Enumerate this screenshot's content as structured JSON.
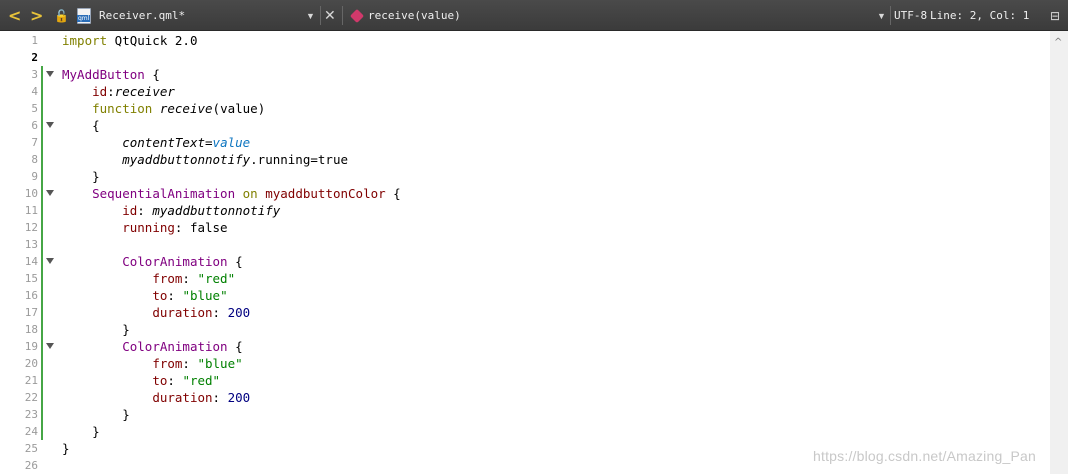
{
  "toolbar": {
    "back_glyph": "<",
    "forward_glyph": ">",
    "lock_glyph": "🔓",
    "file_name": "Receiver.qml*",
    "dropdown_glyph": "▼",
    "close_glyph": "✕",
    "function_name": "receive(value)",
    "function_dropdown_glyph": "▼",
    "encoding": "UTF-8",
    "cursor_position": "Line: 2, Col: 1",
    "split_glyph": "⊟"
  },
  "editor": {
    "current_line": 2,
    "lines": [
      {
        "n": "1",
        "fold": false,
        "code": [
          {
            "t": "import",
            "c": "kw"
          },
          {
            "t": " QtQuick 2.0",
            "c": ""
          }
        ]
      },
      {
        "n": "2",
        "fold": false,
        "code": []
      },
      {
        "n": "3",
        "fold": true,
        "code": [
          {
            "t": "MyAddButton",
            "c": "type"
          },
          {
            "t": " {",
            "c": ""
          }
        ]
      },
      {
        "n": "4",
        "fold": false,
        "code": [
          {
            "t": "    ",
            "c": ""
          },
          {
            "t": "id",
            "c": "prop"
          },
          {
            "t": ":",
            "c": ""
          },
          {
            "t": "receiver",
            "c": "ital"
          }
        ]
      },
      {
        "n": "5",
        "fold": false,
        "code": [
          {
            "t": "    ",
            "c": ""
          },
          {
            "t": "function",
            "c": "kw"
          },
          {
            "t": " ",
            "c": ""
          },
          {
            "t": "receive",
            "c": "ital"
          },
          {
            "t": "(value)",
            "c": ""
          }
        ]
      },
      {
        "n": "6",
        "fold": true,
        "code": [
          {
            "t": "    {",
            "c": ""
          }
        ]
      },
      {
        "n": "7",
        "fold": false,
        "code": [
          {
            "t": "        ",
            "c": ""
          },
          {
            "t": "contentText",
            "c": "ital"
          },
          {
            "t": "=",
            "c": ""
          },
          {
            "t": "value",
            "c": "val"
          }
        ]
      },
      {
        "n": "8",
        "fold": false,
        "code": [
          {
            "t": "        ",
            "c": ""
          },
          {
            "t": "myaddbuttonnotify",
            "c": "ital"
          },
          {
            "t": ".running=true",
            "c": ""
          }
        ]
      },
      {
        "n": "9",
        "fold": false,
        "code": [
          {
            "t": "    }",
            "c": ""
          }
        ]
      },
      {
        "n": "10",
        "fold": true,
        "code": [
          {
            "t": "    ",
            "c": ""
          },
          {
            "t": "SequentialAnimation",
            "c": "type"
          },
          {
            "t": " ",
            "c": ""
          },
          {
            "t": "on",
            "c": "kw"
          },
          {
            "t": " ",
            "c": ""
          },
          {
            "t": "myaddbuttonColor",
            "c": "prop"
          },
          {
            "t": " {",
            "c": ""
          }
        ]
      },
      {
        "n": "11",
        "fold": false,
        "code": [
          {
            "t": "        ",
            "c": ""
          },
          {
            "t": "id",
            "c": "prop"
          },
          {
            "t": ": ",
            "c": ""
          },
          {
            "t": "myaddbuttonnotify",
            "c": "ital"
          }
        ]
      },
      {
        "n": "12",
        "fold": false,
        "code": [
          {
            "t": "        ",
            "c": ""
          },
          {
            "t": "running",
            "c": "prop"
          },
          {
            "t": ": false",
            "c": ""
          }
        ]
      },
      {
        "n": "13",
        "fold": false,
        "code": []
      },
      {
        "n": "14",
        "fold": true,
        "code": [
          {
            "t": "        ",
            "c": ""
          },
          {
            "t": "ColorAnimation",
            "c": "type"
          },
          {
            "t": " {",
            "c": ""
          }
        ]
      },
      {
        "n": "15",
        "fold": false,
        "code": [
          {
            "t": "            ",
            "c": ""
          },
          {
            "t": "from",
            "c": "prop"
          },
          {
            "t": ": ",
            "c": ""
          },
          {
            "t": "\"red\"",
            "c": "str"
          }
        ]
      },
      {
        "n": "16",
        "fold": false,
        "code": [
          {
            "t": "            ",
            "c": ""
          },
          {
            "t": "to",
            "c": "prop"
          },
          {
            "t": ": ",
            "c": ""
          },
          {
            "t": "\"blue\"",
            "c": "str"
          }
        ]
      },
      {
        "n": "17",
        "fold": false,
        "code": [
          {
            "t": "            ",
            "c": ""
          },
          {
            "t": "duration",
            "c": "prop"
          },
          {
            "t": ": ",
            "c": ""
          },
          {
            "t": "200",
            "c": "num"
          }
        ]
      },
      {
        "n": "18",
        "fold": false,
        "code": [
          {
            "t": "        }",
            "c": ""
          }
        ]
      },
      {
        "n": "19",
        "fold": true,
        "code": [
          {
            "t": "        ",
            "c": ""
          },
          {
            "t": "ColorAnimation",
            "c": "type"
          },
          {
            "t": " {",
            "c": ""
          }
        ]
      },
      {
        "n": "20",
        "fold": false,
        "code": [
          {
            "t": "            ",
            "c": ""
          },
          {
            "t": "from",
            "c": "prop"
          },
          {
            "t": ": ",
            "c": ""
          },
          {
            "t": "\"blue\"",
            "c": "str"
          }
        ]
      },
      {
        "n": "21",
        "fold": false,
        "code": [
          {
            "t": "            ",
            "c": ""
          },
          {
            "t": "to",
            "c": "prop"
          },
          {
            "t": ": ",
            "c": ""
          },
          {
            "t": "\"red\"",
            "c": "str"
          }
        ]
      },
      {
        "n": "22",
        "fold": false,
        "code": [
          {
            "t": "            ",
            "c": ""
          },
          {
            "t": "duration",
            "c": "prop"
          },
          {
            "t": ": ",
            "c": ""
          },
          {
            "t": "200",
            "c": "num"
          }
        ]
      },
      {
        "n": "23",
        "fold": false,
        "code": [
          {
            "t": "        }",
            "c": ""
          }
        ]
      },
      {
        "n": "24",
        "fold": false,
        "code": [
          {
            "t": "    }",
            "c": ""
          }
        ]
      },
      {
        "n": "25",
        "fold": false,
        "code": [
          {
            "t": "}",
            "c": ""
          }
        ]
      },
      {
        "n": "26",
        "fold": false,
        "code": []
      }
    ]
  },
  "scrollbar": {
    "up_glyph": "^"
  },
  "watermark": "https://blog.csdn.net/Amazing_Pan",
  "colors": {
    "toolbar_bg": "#3e3e3e",
    "keyword": "#808000",
    "type": "#800080",
    "property": "#800000",
    "string": "#008000",
    "number": "#000080",
    "modified_bar": "#46a646"
  }
}
